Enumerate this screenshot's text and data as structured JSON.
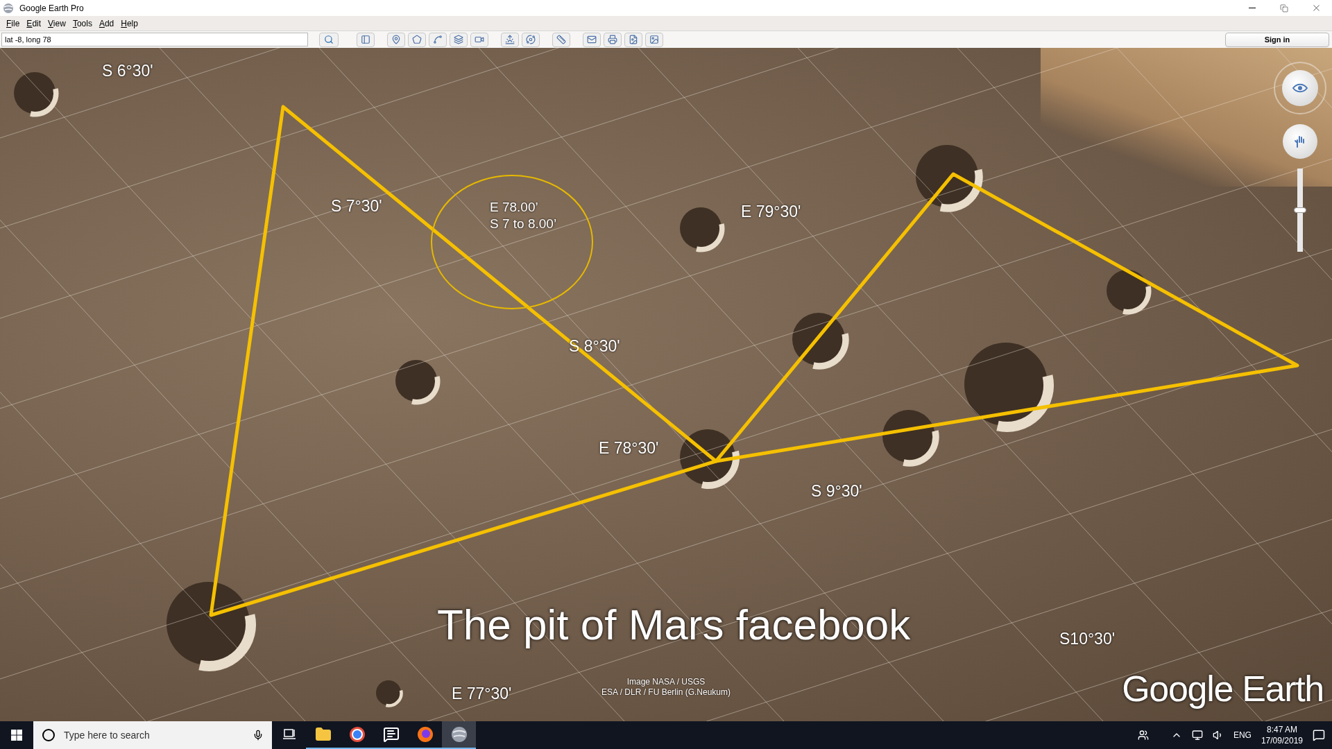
{
  "window": {
    "title": "Google Earth Pro"
  },
  "menu": [
    "File",
    "Edit",
    "View",
    "Tools",
    "Add",
    "Help"
  ],
  "search": {
    "value": "lat -8, long 78"
  },
  "sign_in": "Sign in",
  "map": {
    "grid_labels": [
      "S 6°30'",
      "S 7°30'",
      "E 79°30'",
      "S 8°30'",
      "E 78°30'",
      "S 9°30'",
      "S10°30'",
      "E 77°30'"
    ],
    "circle_label": [
      "E 78.00’",
      "S 7 to 8.00’"
    ],
    "caption": "The pit of Mars facebook",
    "attribution": [
      "Image NASA / USGS",
      "ESA / DLR / FU Berlin (G.Neukum)"
    ],
    "logo": "Google Earth",
    "zoom": {
      "level": 0.5
    }
  },
  "taskbar": {
    "search_placeholder": "Type here to search",
    "apps": [
      {
        "kind": "task-view",
        "running": false,
        "selected": false
      },
      {
        "kind": "folder",
        "running": true,
        "selected": false
      },
      {
        "kind": "browser",
        "running": true,
        "selected": false
      },
      {
        "kind": "chat",
        "running": true,
        "selected": false
      },
      {
        "kind": "firefox",
        "running": true,
        "selected": false
      },
      {
        "kind": "earth",
        "running": true,
        "selected": true
      }
    ],
    "language": "ENG",
    "time": "8:47 AM",
    "date": "17/09/2019"
  }
}
